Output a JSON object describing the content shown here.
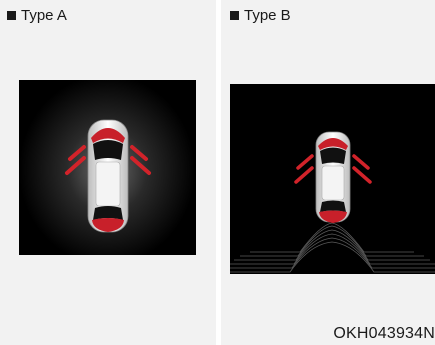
{
  "panels": [
    {
      "label": "Type A",
      "icon": "square-bullet-icon"
    },
    {
      "label": "Type B",
      "icon": "square-bullet-icon"
    }
  ],
  "figure_code": "OKH043934N",
  "colors": {
    "screen_bg": "#000000",
    "sensor_red": "#d2232a",
    "car_body": "#e6e6e6",
    "car_red": "#c8202a"
  }
}
